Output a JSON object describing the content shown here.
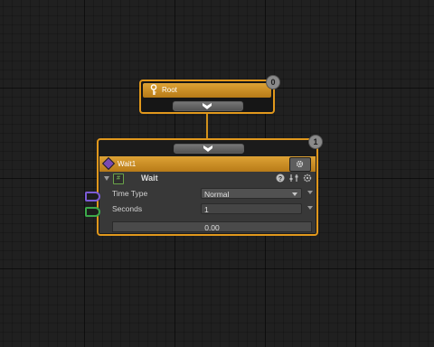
{
  "colors": {
    "node_border": "#e1981c",
    "header": "#dda235",
    "time_type_connector": "#7b5bd6",
    "seconds_connector": "#3ba94a",
    "progress_fill": "#5b7fa6"
  },
  "root": {
    "badge": "0",
    "title": "Root",
    "icon": "key-icon"
  },
  "wait_node": {
    "badge": "1",
    "title": "Wait1",
    "component": {
      "title": "Wait",
      "icons": [
        "help-icon",
        "presets-icon",
        "settings-icon"
      ]
    },
    "fields": {
      "time_type": {
        "label": "Time Type",
        "value": "Normal"
      },
      "seconds": {
        "label": "Seconds",
        "value": "1"
      }
    },
    "progress": {
      "text": "0.00",
      "fraction": 0.0
    }
  }
}
